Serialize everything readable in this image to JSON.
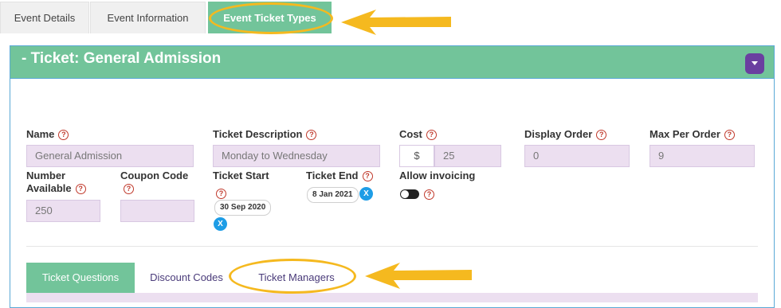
{
  "tabs": {
    "details": "Event Details",
    "information": "Event Information",
    "ticket_types": "Event Ticket Types"
  },
  "panel": {
    "title": "- Ticket: General Admission"
  },
  "form": {
    "name_label": "Name",
    "name_value": "General Admission",
    "description_label": "Ticket Description",
    "description_value": "Monday to Wednesday",
    "cost_label": "Cost",
    "cost_prefix": "$",
    "cost_value": "25",
    "display_order_label": "Display Order",
    "display_order_value": "0",
    "max_per_order_label": "Max Per Order",
    "max_per_order_value": "9",
    "number_available_label_1": "Number",
    "number_available_label_2": "Available",
    "number_available_value": "250",
    "coupon_code_label": "Coupon Code",
    "coupon_code_value": "",
    "ticket_start_label": "Ticket Start",
    "ticket_start_value": "30 Sep 2020",
    "ticket_end_label": "Ticket End",
    "ticket_end_value": "8 Jan 2021",
    "allow_invoicing_label": "Allow invoicing",
    "help_glyph": "?",
    "clear_glyph": "X"
  },
  "bottom_tabs": {
    "questions": "Ticket Questions",
    "discount": "Discount Codes",
    "managers": "Ticket Managers"
  },
  "colors": {
    "accent_green": "#72c49a",
    "annotation_yellow": "#f5b91f",
    "input_bg": "#ecdff0",
    "toggle_purple": "#6a3fa0",
    "clear_blue": "#1e9de6"
  },
  "icons": {
    "help": "question-circle-icon",
    "clear": "clear-x-icon",
    "collapse": "chevron-down-icon"
  }
}
